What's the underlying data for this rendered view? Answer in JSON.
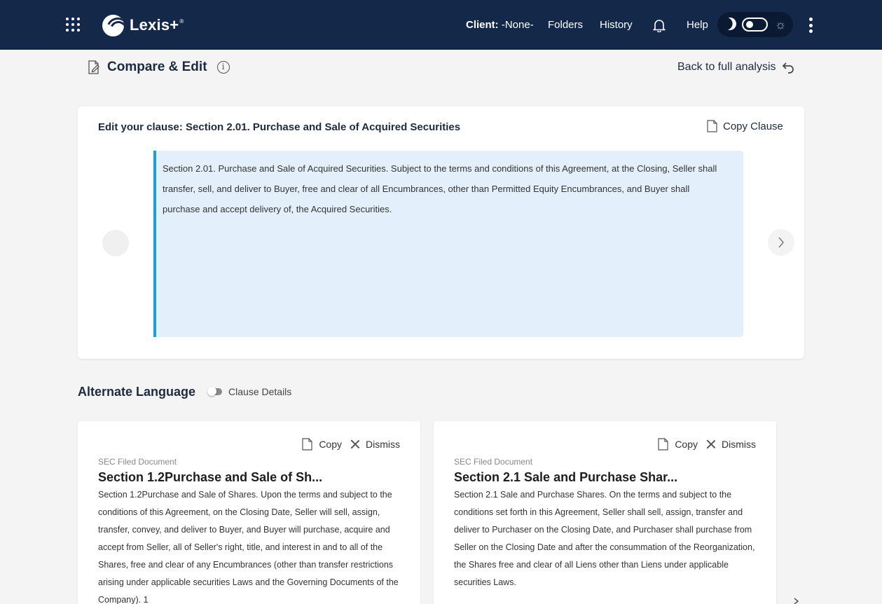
{
  "topbar": {
    "brand": "Lexis+",
    "brand_reg": "®",
    "client_label": "Client:",
    "client_value": "-None-",
    "folders": "Folders",
    "history": "History",
    "help": "Help"
  },
  "header": {
    "title": "Compare & Edit",
    "back_link": "Back to full analysis"
  },
  "editor": {
    "title": "Edit your clause: Section 2.01. Purchase and Sale of Acquired Securities",
    "copy_clause": "Copy Clause",
    "clause_text": "Section 2.01. Purchase and Sale of Acquired Securities. Subject to the terms and conditions of this Agreement, at the Closing, Seller shall transfer, sell, and deliver to Buyer, free and clear of all Encumbrances, other than Permitted Equity Encumbrances, and Buyer shall purchase and accept delivery of, the Acquired Securities."
  },
  "alternate": {
    "title": "Alternate Language",
    "details_toggle": "Clause Details",
    "cards": [
      {
        "copy": "Copy",
        "dismiss": "Dismiss",
        "source": "SEC Filed Document",
        "title": "Section 1.2Purchase and Sale of Sh...",
        "text": "Section 1.2Purchase and Sale of Shares. Upon the terms and subject to the conditions of this Agreement, on the Closing Date, Seller will sell, assign, transfer, convey, and deliver to Buyer, and Buyer will purchase, acquire and accept from Seller, all of Seller's right, title, and interest in and to all of the Shares, free and clear of any Encumbrances (other than transfer restrictions arising under applicable securities Laws and the Governing Documents of the Company). 1"
      },
      {
        "copy": "Copy",
        "dismiss": "Dismiss",
        "source": "SEC Filed Document",
        "title": "Section 2.1 Sale and Purchase Shar...",
        "text": "Section 2.1 Sale and Purchase Shares. On the terms and subject to the conditions set forth in this Agreement, Seller shall sell, assign, transfer and deliver to Purchaser on the Closing Date, and Purchaser shall purchase from Seller on the Closing Date and after the consummation of the Reorganization, the Shares free and clear of all Liens other than Liens under applicable securities Laws."
      }
    ]
  },
  "colors": {
    "topbar": "#14294a",
    "accent": "#1b9de0",
    "clause_bg": "#e3f0fb"
  },
  "icons": [
    "apps-grid-icon",
    "lexis-logo-icon",
    "bell-icon",
    "moon-icon",
    "sun-icon",
    "kebab-menu-icon",
    "edit-document-icon",
    "info-icon",
    "back-arrow-icon",
    "copy-document-icon",
    "chevron-left-icon",
    "chevron-right-icon",
    "close-icon"
  ]
}
